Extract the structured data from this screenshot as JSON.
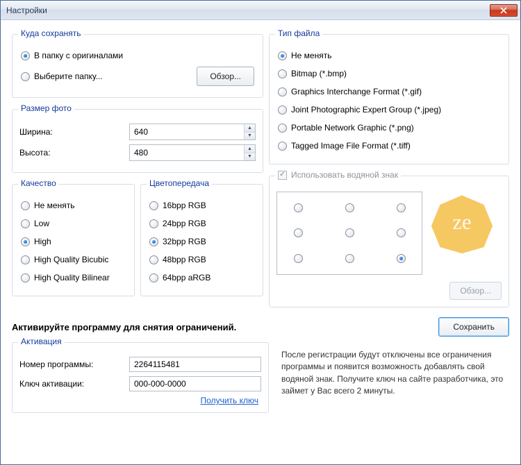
{
  "window": {
    "title": "Настройки"
  },
  "save_to": {
    "legend": "Куда сохранять",
    "opt_originals": "В папку с оригиналами",
    "opt_choose": "Выберите папку...",
    "browse": "Обзор...",
    "selected": "originals"
  },
  "size": {
    "legend": "Размер фото",
    "width_label": "Ширина:",
    "height_label": "Высота:",
    "width": "640",
    "height": "480"
  },
  "quality": {
    "legend": "Качество",
    "options": [
      "Не менять",
      "Low",
      "High",
      "High Quality Bicubic",
      "High Quality Bilinear"
    ],
    "selected_index": 2
  },
  "color": {
    "legend": "Цветопередача",
    "options": [
      "16bpp RGB",
      "24bpp RGB",
      "32bpp RGB",
      "48bpp RGB",
      "64bpp aRGB"
    ],
    "selected_index": 2
  },
  "filetype": {
    "legend": "Тип файла",
    "options": [
      "Не менять",
      "Bitmap (*.bmp)",
      "Graphics Interchange Format (*.gif)",
      "Joint Photographic Expert Group (*.jpeg)",
      "Portable Network Graphic (*.png)",
      "Tagged Image File Format (*.tiff)"
    ],
    "selected_index": 0
  },
  "watermark": {
    "use_label": "Использовать водяной знак",
    "enabled": false,
    "browse": "Обзор...",
    "position_index": 8
  },
  "save_button": "Сохранить",
  "activate_title": "Активируйте программу для снятия ограничений.",
  "activation": {
    "legend": "Активация",
    "program_label": "Номер программы:",
    "program_value": "2264115481",
    "key_label": "Ключ активации:",
    "key_value": "000-000-0000",
    "get_key_link": "Получить ключ"
  },
  "activation_info": "После регистрации будут  отключены  все ограничения программы и появится возможность добавлять свой водяной знак. Получите ключ на сайте разработчика, это займет у Вас  всего 2 минуты."
}
